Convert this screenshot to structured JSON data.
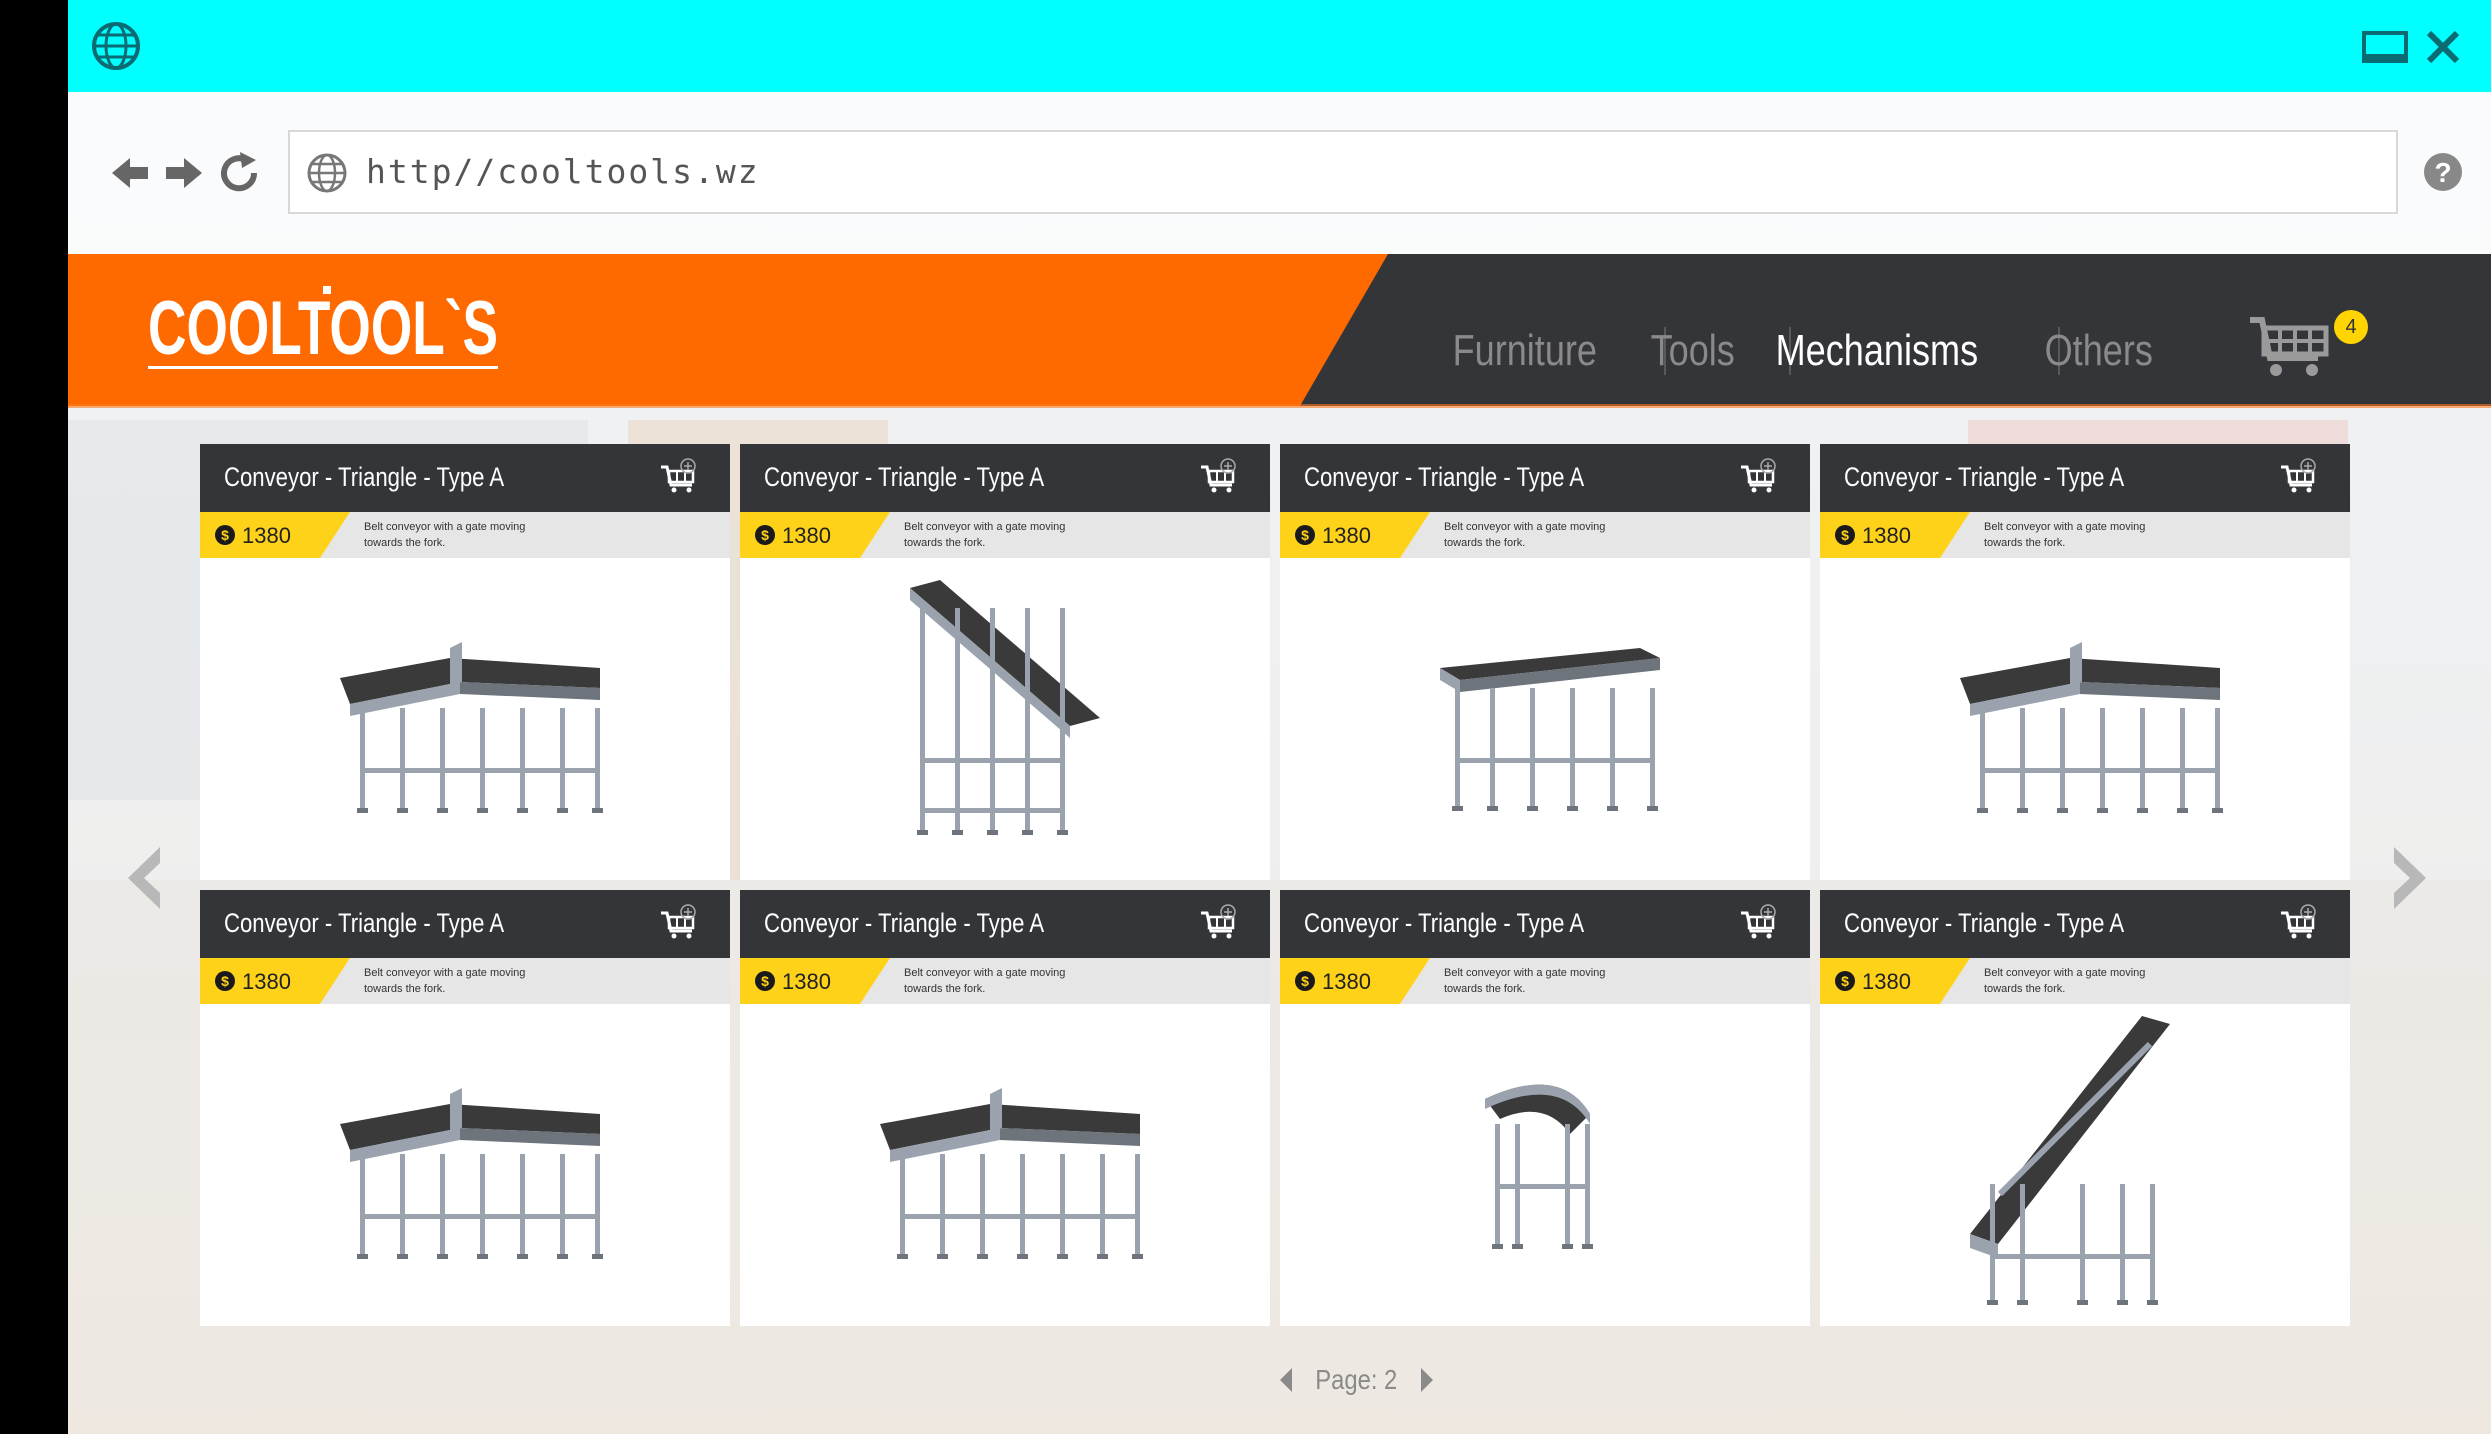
{
  "browser": {
    "url": "http//cooltools.wz"
  },
  "site": {
    "logo_text": "COOLTOOL`S",
    "menu": [
      {
        "label": "Furniture",
        "active": false
      },
      {
        "label": "Tools",
        "active": false
      },
      {
        "label": "Mechanisms",
        "active": true
      },
      {
        "label": "Others",
        "active": false
      }
    ],
    "cart_count": "4",
    "accent_color": "#ff6a00",
    "dark_color": "#333538",
    "price_color": "#ffd21a"
  },
  "products": [
    {
      "title": "Conveyor - Triangle - Type A",
      "price": "1380",
      "description": "Belt conveyor with a gate moving towards the fork.",
      "image": "conveyor-fork"
    },
    {
      "title": "Conveyor - Triangle - Type A",
      "price": "1380",
      "description": "Belt conveyor with a gate moving towards the fork.",
      "image": "conveyor-incline"
    },
    {
      "title": "Conveyor - Triangle - Type A",
      "price": "1380",
      "description": "Belt conveyor with a gate moving towards the fork.",
      "image": "conveyor-straight"
    },
    {
      "title": "Conveyor - Triangle - Type A",
      "price": "1380",
      "description": "Belt conveyor with a gate moving towards the fork.",
      "image": "conveyor-tee"
    },
    {
      "title": "Conveyor - Triangle - Type A",
      "price": "1380",
      "description": "Belt conveyor with a gate moving towards the fork.",
      "image": "conveyor-merge"
    },
    {
      "title": "Conveyor - Triangle - Type A",
      "price": "1380",
      "description": "Belt conveyor with a gate moving towards the fork.",
      "image": "conveyor-gate"
    },
    {
      "title": "Conveyor - Triangle - Type A",
      "price": "1380",
      "description": "Belt conveyor with a gate moving towards the fork.",
      "image": "conveyor-curve"
    },
    {
      "title": "Conveyor - Triangle - Type A",
      "price": "1380",
      "description": "Belt conveyor with a gate moving towards the fork.",
      "image": "conveyor-incline-long"
    }
  ],
  "pager": {
    "label": "Page: 2"
  }
}
